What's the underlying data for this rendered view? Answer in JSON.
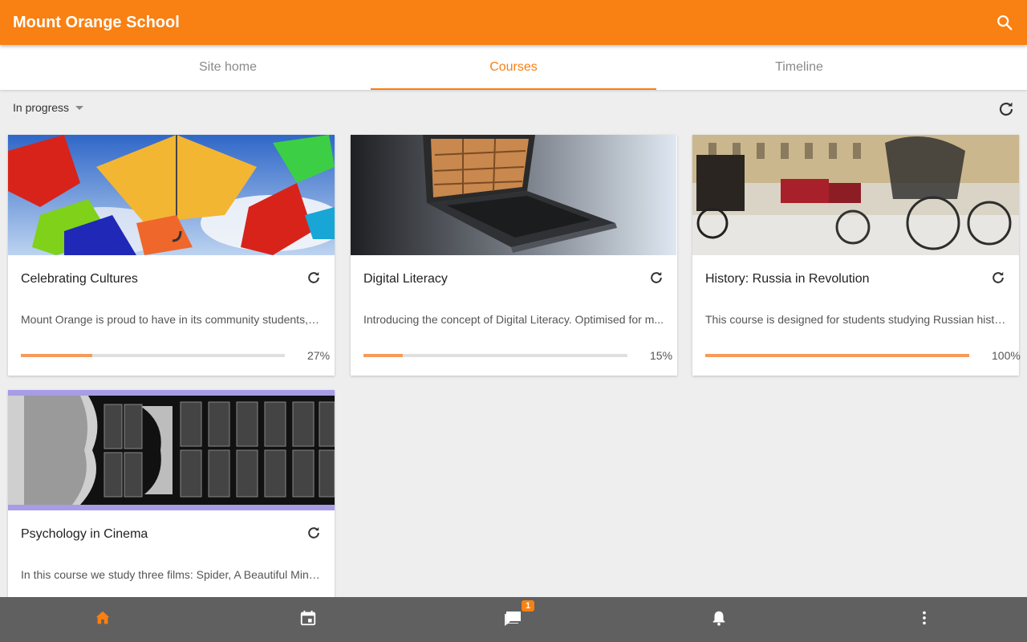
{
  "appbar": {
    "title": "Mount Orange School",
    "search_icon": "search-icon"
  },
  "tabs": [
    {
      "label": "Site home",
      "active": false
    },
    {
      "label": "Courses",
      "active": true
    },
    {
      "label": "Timeline",
      "active": false
    }
  ],
  "filter": {
    "selected": "In progress"
  },
  "courses": [
    {
      "name": "Celebrating Cultures",
      "summary": "Mount Orange is proud to have in its community students, t...",
      "progress": 27,
      "progress_label": "27%"
    },
    {
      "name": "Digital Literacy",
      "summary": "Introducing the concept of Digital Literacy. Optimised for m...",
      "progress": 15,
      "progress_label": "15%"
    },
    {
      "name": "History: Russia in Revolution",
      "summary": "This course is designed for students studying Russian histo...",
      "progress": 100,
      "progress_label": "100%"
    },
    {
      "name": "Psychology in Cinema",
      "summary": "In this course we study three films: Spider, A Beautiful Mind,...",
      "progress": null,
      "progress_label": null
    }
  ],
  "bottom_nav": [
    {
      "icon": "home-icon",
      "active": true
    },
    {
      "icon": "calendar-icon",
      "active": false
    },
    {
      "icon": "messages-icon",
      "badge": "1",
      "active": false
    },
    {
      "icon": "bell-icon",
      "active": false
    },
    {
      "icon": "more-vertical-icon",
      "active": false
    }
  ],
  "colors": {
    "brand": "#f98012",
    "progress_fill": "#f59b5c",
    "bottom_bar": "#606060"
  }
}
